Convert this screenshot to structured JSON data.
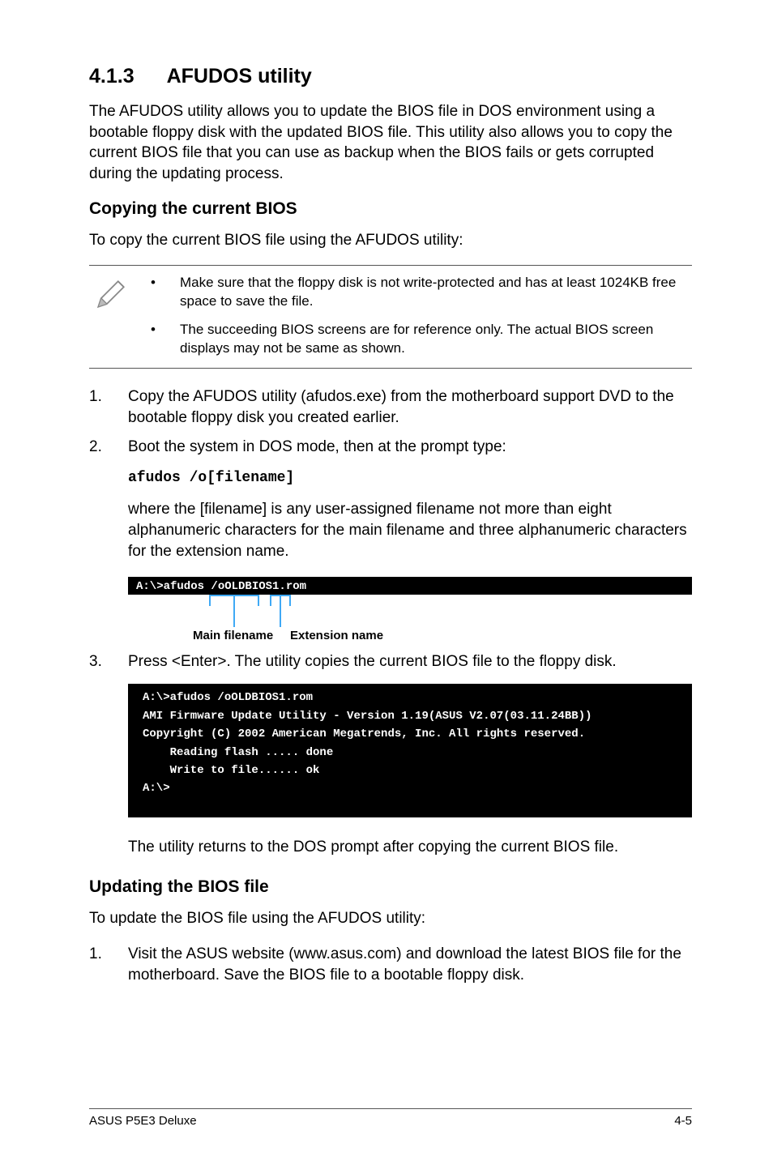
{
  "heading": {
    "number": "4.1.3",
    "title": "AFUDOS utility"
  },
  "intro": "The AFUDOS utility allows you to update the BIOS file in DOS environment using a bootable floppy disk with the updated BIOS file. This utility also allows you to copy the current BIOS file that you can use as backup when the BIOS fails or gets corrupted during the updating process.",
  "copy_heading": "Copying the current BIOS",
  "copy_intro": "To copy the current BIOS file using the AFUDOS utility:",
  "note_items": [
    "Make sure that the floppy disk is not write-protected and has at least 1024KB free space to save the file.",
    "The succeeding BIOS screens are for reference only. The actual BIOS screen displays may not be same as shown."
  ],
  "step1": "Copy the AFUDOS utility (afudos.exe) from the motherboard support DVD to the bootable floppy disk you created earlier.",
  "step2": "Boot the system in DOS mode, then at the prompt type:",
  "cmd1": "afudos /o[filename]",
  "where_text": "where the [filename] is any user-assigned filename not more than eight alphanumeric characters  for the main filename and three alphanumeric characters for the extension name.",
  "term_narrow": "A:\\>afudos /oOLDBIOS1.rom",
  "anno_main": "Main filename",
  "anno_ext": "Extension name",
  "step3": "Press <Enter>. The utility copies the current BIOS file to the floppy disk.",
  "terminal_full": "A:\\>afudos /oOLDBIOS1.rom\nAMI Firmware Update Utility - Version 1.19(ASUS V2.07(03.11.24BB))\nCopyright (C) 2002 American Megatrends, Inc. All rights reserved.\n    Reading flash ..... done\n    Write to file...... ok\nA:\\>",
  "return_text": "The utility returns to the DOS prompt after copying the current BIOS file.",
  "update_heading": "Updating the BIOS file",
  "update_intro": "To update the BIOS file using the AFUDOS utility:",
  "update_step1": "Visit the ASUS website (www.asus.com) and download the latest BIOS file for the motherboard. Save the BIOS file to a bootable floppy disk.",
  "footer_left": "ASUS P5E3 Deluxe",
  "footer_right": "4-5"
}
